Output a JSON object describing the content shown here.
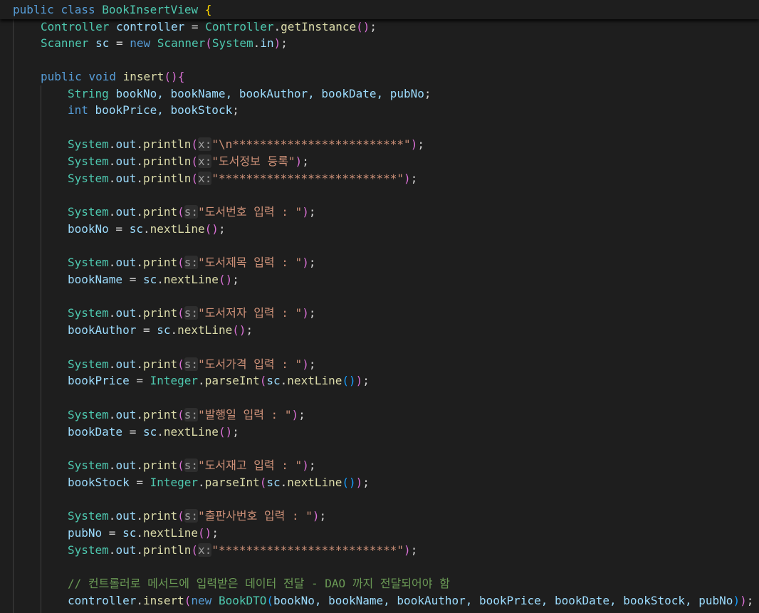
{
  "editor": {
    "class_decl": {
      "kw1": "public",
      "kw2": "class",
      "name": "BookInsertView",
      "brace": "{"
    },
    "line_controller": {
      "type": "Controller",
      "var": "controller",
      "eq": " = ",
      "cls": "Controller",
      "dot": ".",
      "fn": "getInstance",
      "open": "(",
      "close": ")",
      "end": ";"
    },
    "line_scanner": {
      "type": "Scanner",
      "var": "sc",
      "eq": " = ",
      "kw": "new",
      "cls": "Scanner",
      "open": "(",
      "arg_cls": "System",
      "dot": ".",
      "arg_var": "in",
      "close": ")",
      "end": ";"
    },
    "method_decl": {
      "kw1": "public",
      "kw2": "void",
      "fn": "insert",
      "open": "(",
      "close": ")",
      "brace": "{"
    },
    "decl_strings": {
      "type": "String",
      "vars": "bookNo, bookName, bookAuthor, bookDate, pubNo",
      "end": ";"
    },
    "decl_ints": {
      "type": "int",
      "vars": "bookPrice, bookStock",
      "end": ";"
    },
    "print_calls": [
      {
        "fn": "println",
        "hint": "x:",
        "text": "\"\\n*************************\""
      },
      {
        "fn": "println",
        "hint": "x:",
        "text": "\"도서정보 등록\""
      },
      {
        "fn": "println",
        "hint": "x:",
        "text": "\"**************************\""
      },
      {
        "fn": "print",
        "hint": "s:",
        "text": "\"도서번호 입력 : \""
      },
      {
        "fn": "print",
        "hint": "s:",
        "text": "\"도서제목 입력 : \""
      },
      {
        "fn": "print",
        "hint": "s:",
        "text": "\"도서저자 입력 : \""
      },
      {
        "fn": "print",
        "hint": "s:",
        "text": "\"도서가격 입력 : \""
      },
      {
        "fn": "print",
        "hint": "s:",
        "text": "\"발행일 입력 : \""
      },
      {
        "fn": "print",
        "hint": "s:",
        "text": "\"도서재고 입력 : \""
      },
      {
        "fn": "print",
        "hint": "s:",
        "text": "\"출판사번호 입력 : \""
      },
      {
        "fn": "println",
        "hint": "x:",
        "text": "\"**************************\""
      }
    ],
    "system_out": {
      "cls": "System",
      "dot": ".",
      "field": "out",
      "dot2": "."
    },
    "read_lines": [
      {
        "var": "bookNo"
      },
      {
        "var": "bookName"
      },
      {
        "var": "bookAuthor"
      },
      {
        "var": "bookDate"
      },
      {
        "var": "pubNo"
      }
    ],
    "parse_lines": [
      {
        "var": "bookPrice"
      },
      {
        "var": "bookStock"
      }
    ],
    "next_line": {
      "sc": "sc",
      "dot": ".",
      "fn": "nextLine",
      "parens": "()",
      "end": ";"
    },
    "parse_int": {
      "cls": "Integer",
      "dot": ".",
      "fn": "parseInt",
      "open": "(",
      "close": ")",
      "end": ";"
    },
    "comment": "// 컨트롤러로 메서드에 입력받은 데이터 전달 - DAO 까지 전달되어야 함",
    "final_call": {
      "var": "controller",
      "dot": ".",
      "fn": "insert",
      "open": "(",
      "kw": "new",
      "cls": "BookDTO",
      "open2": "(",
      "args": "bookNo, bookName, bookAuthor, bookPrice, bookDate, bookStock, pubNo",
      "close2": ")",
      "close": ")",
      "end": ";"
    },
    "eq": " = "
  }
}
